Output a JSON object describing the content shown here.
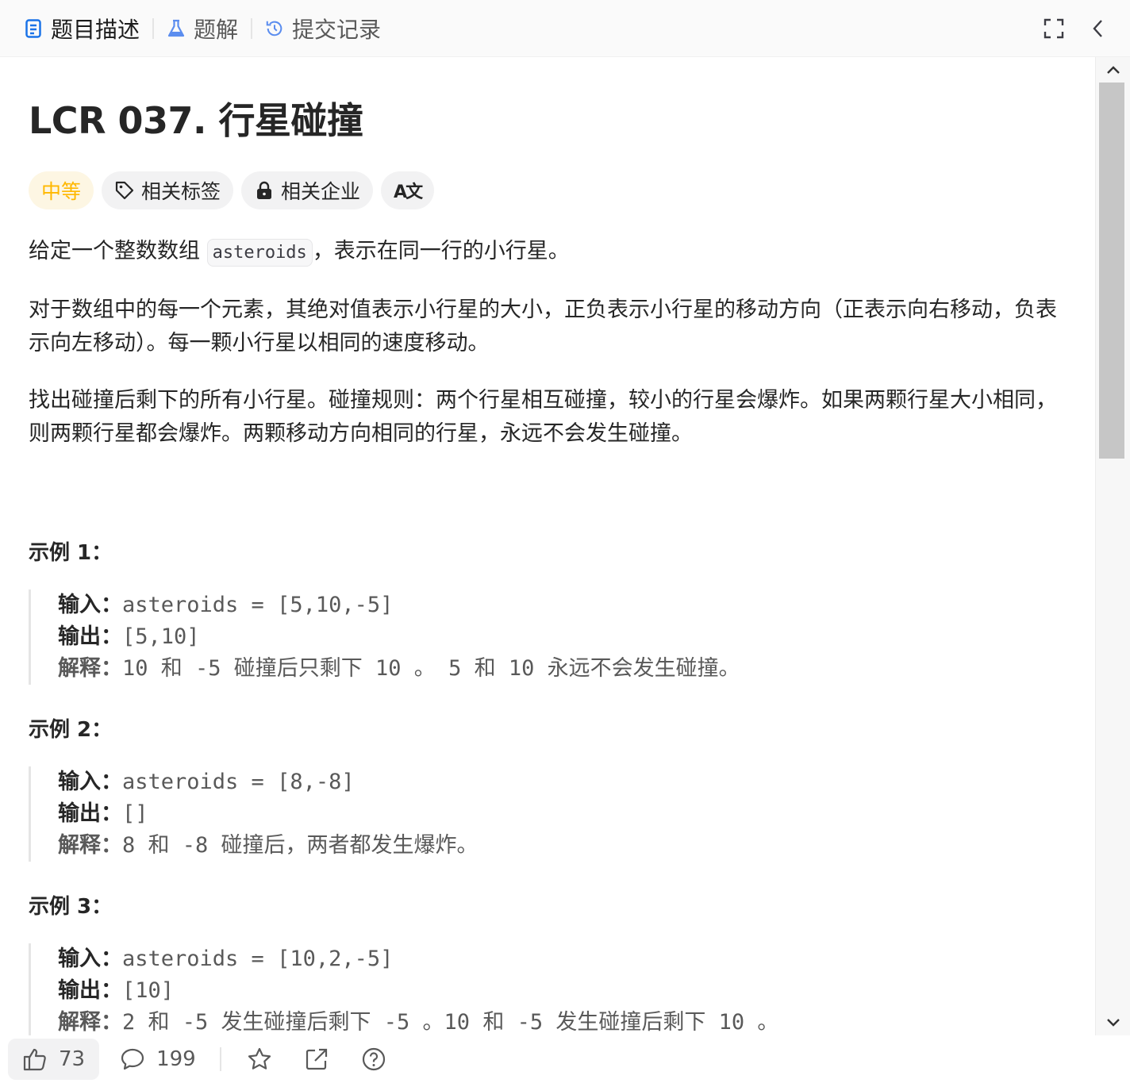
{
  "tabs": [
    {
      "label": "题目描述",
      "icon": "document-icon",
      "active": true
    },
    {
      "label": "题解",
      "icon": "flask-icon",
      "active": false
    },
    {
      "label": "提交记录",
      "icon": "history-icon",
      "active": false
    }
  ],
  "problem": {
    "title": "LCR 037. 行星碰撞",
    "difficulty": "中等",
    "tags": {
      "related_tags": "相关标签",
      "related_companies": "相关企业",
      "translate": "A文"
    },
    "desc1_pre": "给定一个整数数组 ",
    "desc1_code": "asteroids",
    "desc1_post": "，表示在同一行的小行星。",
    "desc2": "对于数组中的每一个元素，其绝对值表示小行星的大小，正负表示小行星的移动方向（正表示向右移动，负表示向左移动）。每一颗小行星以相同的速度移动。",
    "desc3": "找出碰撞后剩下的所有小行星。碰撞规则：两个行星相互碰撞，较小的行星会爆炸。如果两颗行星大小相同，则两颗行星都会爆炸。两颗移动方向相同的行星，永远不会发生碰撞。"
  },
  "examples": [
    {
      "heading": "示例 1：",
      "input_label": "输入：",
      "input": "asteroids = [5,10,-5]",
      "output_label": "输出：",
      "output": "[5,10]",
      "explain_label": "解释：",
      "explain": "10 和 -5 碰撞后只剩下 10 。 5 和 10 永远不会发生碰撞。"
    },
    {
      "heading": "示例 2：",
      "input_label": "输入：",
      "input": "asteroids = [8,-8]",
      "output_label": "输出：",
      "output": "[]",
      "explain_label": "解释：",
      "explain": "8 和 -8 碰撞后，两者都发生爆炸。"
    },
    {
      "heading": "示例 3：",
      "input_label": "输入：",
      "input": "asteroids = [10,2,-5]",
      "output_label": "输出：",
      "output": "[10]",
      "explain_label": "解释：",
      "explain": "2 和 -5 发生碰撞后剩下 -5 。10 和 -5 发生碰撞后剩下 10 。"
    }
  ],
  "bottom": {
    "likes": "73",
    "comments": "199"
  },
  "colors": {
    "difficulty": "#ffb800",
    "tab_active_icon": "#1a73e8"
  }
}
